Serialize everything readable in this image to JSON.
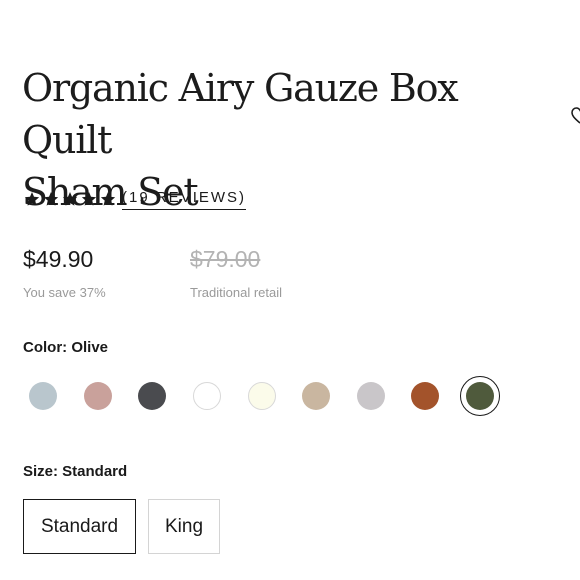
{
  "product": {
    "title_line1": "Organic Airy Gauze Box Quilt",
    "title_line2": "Sham Set",
    "rating": 5,
    "reviews_label": "(19 REVIEWS)"
  },
  "pricing": {
    "price": "$49.90",
    "savings": "You save 37%",
    "retail_price": "$79.00",
    "retail_note": "Traditional retail"
  },
  "color": {
    "label": "Color: Olive",
    "selected": "Olive",
    "swatches": [
      {
        "color": "#b9c6cd"
      },
      {
        "color": "#c9a19b"
      },
      {
        "color": "#4a4b4f"
      },
      {
        "color": "#ffffff"
      },
      {
        "color": "#fbfbea"
      },
      {
        "color": "#c9b6a0"
      },
      {
        "color": "#c9c6c9"
      },
      {
        "color": "#a3532b"
      },
      {
        "color": "#4f5a3c"
      }
    ]
  },
  "size": {
    "label": "Size: Standard",
    "options": [
      "Standard",
      "King"
    ],
    "selected": "Standard"
  }
}
